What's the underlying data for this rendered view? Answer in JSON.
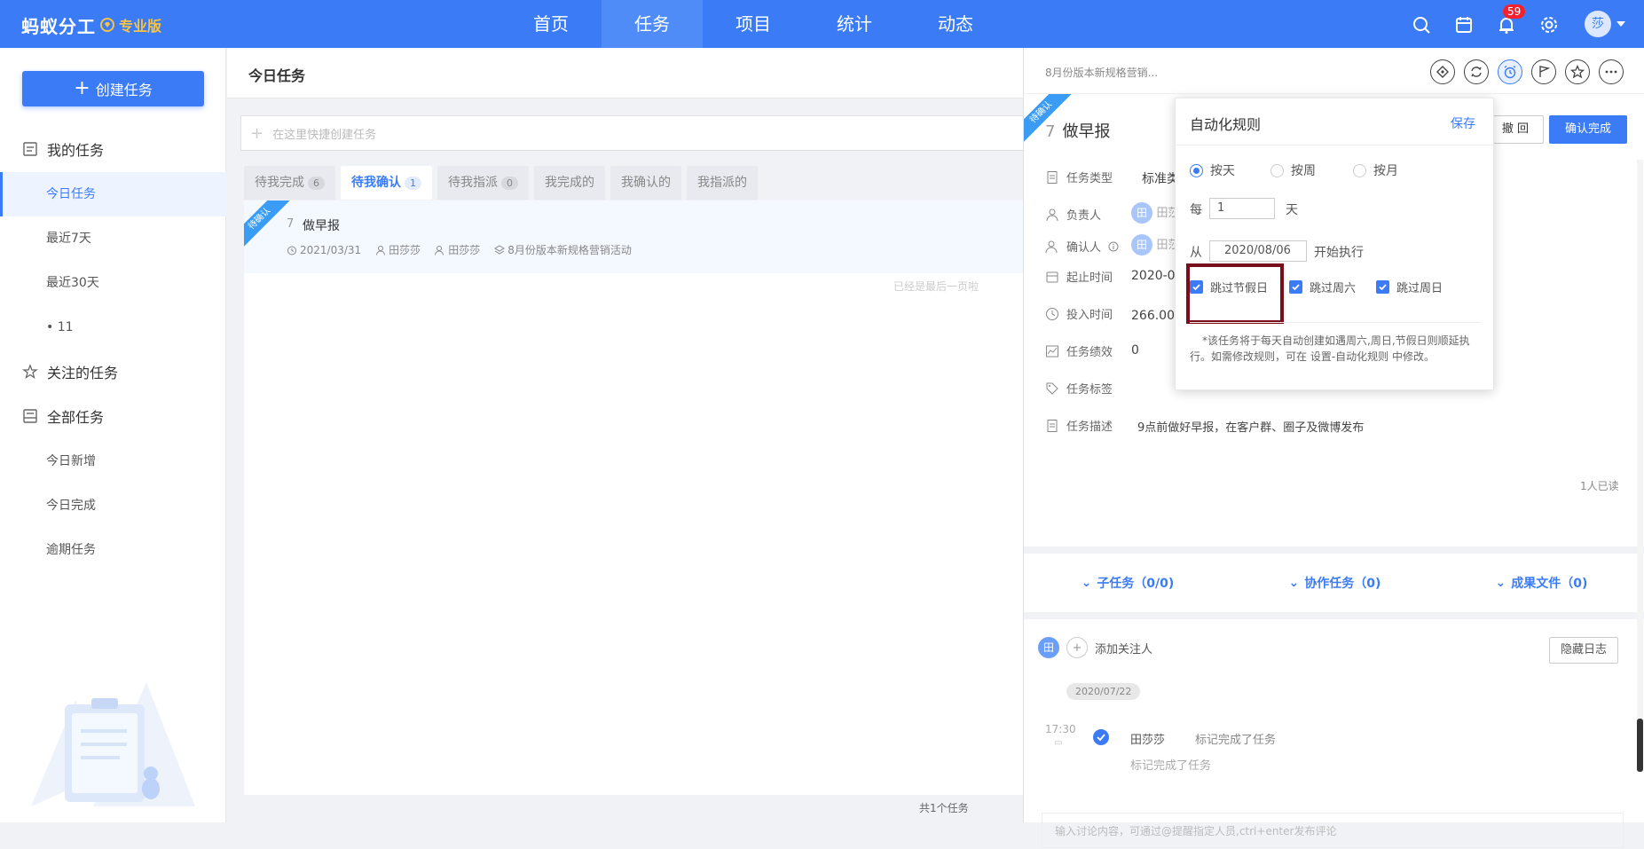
{
  "topbar": {
    "logo": "蚂蚁分工",
    "edition": "专业版",
    "nav": [
      "首页",
      "任务",
      "项目",
      "统计",
      "动态"
    ],
    "active_nav": "任务",
    "notification_count": "59",
    "avatar_text": "莎",
    "accent_color": "#3b7cf6"
  },
  "sidebar": {
    "create_button": "创建任务",
    "my_tasks": "我的任务",
    "my_items": [
      "今日任务",
      "最近7天",
      "最近30天",
      "• 11"
    ],
    "followed": "关注的任务",
    "all_tasks": "全部任务",
    "all_items": [
      "今日新增",
      "今日完成",
      "逾期任务"
    ]
  },
  "main": {
    "title": "今日任务",
    "quick_create_placeholder": "在这里快捷创建任务",
    "tabs": [
      {
        "label": "待我完成",
        "count": "6"
      },
      {
        "label": "待我确认",
        "count": "1"
      },
      {
        "label": "待我指派",
        "count": "0"
      },
      {
        "label": "我完成的",
        "count": ""
      },
      {
        "label": "我确认的",
        "count": ""
      },
      {
        "label": "我指派的",
        "count": ""
      }
    ],
    "task": {
      "ribbon": "待确认",
      "number": "7",
      "name": "做早报",
      "date": "2021/03/31",
      "owner": "田莎莎",
      "confirmer": "田莎莎",
      "project": "8月份版本新规格营销活动"
    },
    "last_page_text": "已经是最后一页啦",
    "total_text": "共1个任务"
  },
  "detail": {
    "breadcrumb": "8月份版本新规格营销...",
    "ribbon": "待确认",
    "task_number": "7",
    "task_title": "做早报",
    "undo_button": "撤 回",
    "confirm_button": "确认完成",
    "fields": {
      "type_label": "任务类型",
      "type_value": "标准类",
      "owner_label": "负责人",
      "owner_value": "田莎",
      "confirmer_label": "确认人",
      "confirmer_value": "田莎",
      "time_label": "起止时间",
      "time_value": "2020-07",
      "effort_label": "投入时间",
      "effort_value": "266.00天",
      "perf_label": "任务绩效",
      "perf_value": "0",
      "tag_label": "任务标签",
      "desc_label": "任务描述",
      "desc_value": "9点前做好早报，在客户群、圈子及微博发布"
    },
    "avatar_char": "田",
    "read_count": "1人已读",
    "sub_tabs": [
      "子任务（0/0)",
      "协作任务（0)",
      "成果文件（0)"
    ],
    "add_watcher": "添加关注人",
    "hide_log_button": "隐藏日志",
    "log": {
      "date": "2020/07/22",
      "time": "17:30",
      "user": "田莎莎",
      "action": "标记完成了任务",
      "detail": "标记完成了任务"
    },
    "comment_placeholder": "输入讨论内容，可通过@提醒指定人员,ctrl+enter发布评论"
  },
  "automation_popup": {
    "title": "自动化规则",
    "save": "保存",
    "options": [
      "按天",
      "按周",
      "按月"
    ],
    "selected_option": "按天",
    "every_label": "每",
    "every_value": "1",
    "every_unit": "天",
    "from_label": "从",
    "from_date": "2020/08/06",
    "start_text": "开始执行",
    "skip_options": [
      "跳过节假日",
      "跳过周六",
      "跳过周日"
    ],
    "note": "*该任务将于每天自动创建如遇周六,周日,节假日则顺延执行。如需修改规则，可在 设置-自动化规则 中修改。",
    "highlight_color": "#7a0d1b"
  }
}
